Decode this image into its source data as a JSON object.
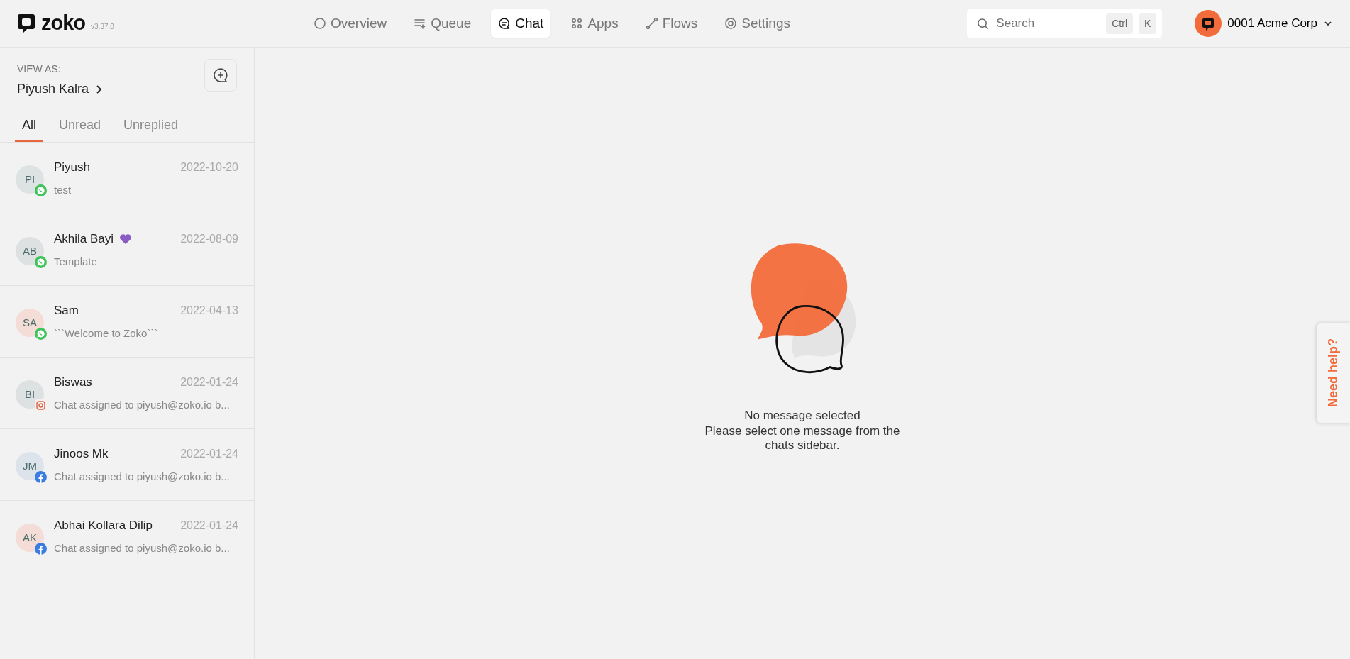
{
  "brand": {
    "name": "zoko",
    "version": "v3.37.0"
  },
  "nav": [
    {
      "label": "Overview",
      "kind": "overview",
      "selected": false
    },
    {
      "label": "Queue",
      "kind": "queue",
      "selected": false
    },
    {
      "label": "Chat",
      "kind": "chat",
      "selected": true
    },
    {
      "label": "Apps",
      "kind": "apps",
      "selected": false
    },
    {
      "label": "Flows",
      "kind": "flows",
      "selected": false
    },
    {
      "label": "Settings",
      "kind": "settings",
      "selected": false
    }
  ],
  "search": {
    "placeholder": "Search",
    "keys": [
      "Ctrl",
      "K"
    ]
  },
  "account": {
    "name": "0001 Acme Corp"
  },
  "sidebar": {
    "view_as_label": "VIEW AS:",
    "view_as_user": "Piyush Kalra",
    "tabs": [
      {
        "label": "All",
        "selected": true
      },
      {
        "label": "Unread",
        "selected": false
      },
      {
        "label": "Unreplied",
        "selected": false
      }
    ],
    "chats": [
      {
        "initials": "PI",
        "name": "Piyush",
        "heart": false,
        "date": "2022-10-20",
        "preview": "test",
        "kind": "whatsapp",
        "color": "#dde3e3"
      },
      {
        "initials": "AB",
        "name": "Akhila Bayi",
        "heart": true,
        "date": "2022-08-09",
        "preview": "Template",
        "kind": "whatsapp",
        "color": "#dde1e2"
      },
      {
        "initials": "SA",
        "name": "Sam",
        "heart": false,
        "date": "2022-04-13",
        "preview": "```Welcome to Zoko```",
        "kind": "whatsapp",
        "color": "#f4ddd6"
      },
      {
        "initials": "BI",
        "name": "Biswas",
        "heart": false,
        "date": "2022-01-24",
        "preview": "Chat assigned to piyush@zoko.io b...",
        "kind": "instagram",
        "color": "#dde1e2"
      },
      {
        "initials": "JM",
        "name": "Jinoos Mk",
        "heart": false,
        "date": "2022-01-24",
        "preview": "Chat assigned to piyush@zoko.io b...",
        "kind": "facebook",
        "color": "#dde3ea"
      },
      {
        "initials": "AK",
        "name": "Abhai Kollara Dilip",
        "heart": false,
        "date": "2022-01-24",
        "preview": "Chat assigned to piyush@zoko.io b...",
        "kind": "facebook",
        "color": "#f4ddd6"
      }
    ]
  },
  "empty_state": {
    "title": "No message selected",
    "message": "Please select one message from the chats sidebar."
  },
  "help_tab": {
    "label": "Need help?"
  }
}
